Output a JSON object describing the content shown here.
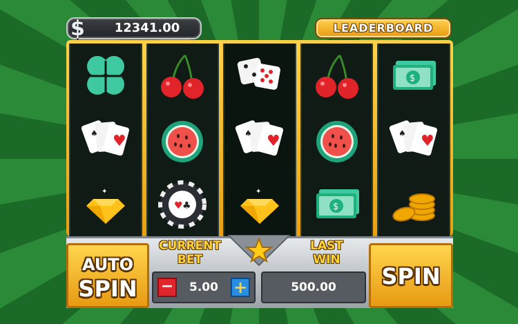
{
  "balance": {
    "currency_icon": "dollar-sign-icon",
    "value": "12341.00"
  },
  "leaderboard_label": "LEADERBOARD",
  "reels": [
    [
      "clover",
      "cards",
      "diamond"
    ],
    [
      "cherries",
      "watermelon",
      "poker-chip"
    ],
    [
      "dice",
      "cards",
      "diamond"
    ],
    [
      "cherries",
      "watermelon",
      "money"
    ],
    [
      "money",
      "cards",
      "coins"
    ]
  ],
  "auto_spin": {
    "line1": "AUTO",
    "line2": "SPIN"
  },
  "current_bet": {
    "label1": "CURRENT",
    "label2": "BET",
    "value": "5.00",
    "minus": "−",
    "plus": "+"
  },
  "last_win": {
    "label1": "LAST",
    "label2": "WIN",
    "value": "500.00"
  },
  "spin_label": "SPIN",
  "colors": {
    "gold": "#ffd24a",
    "green": "#2b8a37",
    "panel": "#c3c8cd"
  }
}
